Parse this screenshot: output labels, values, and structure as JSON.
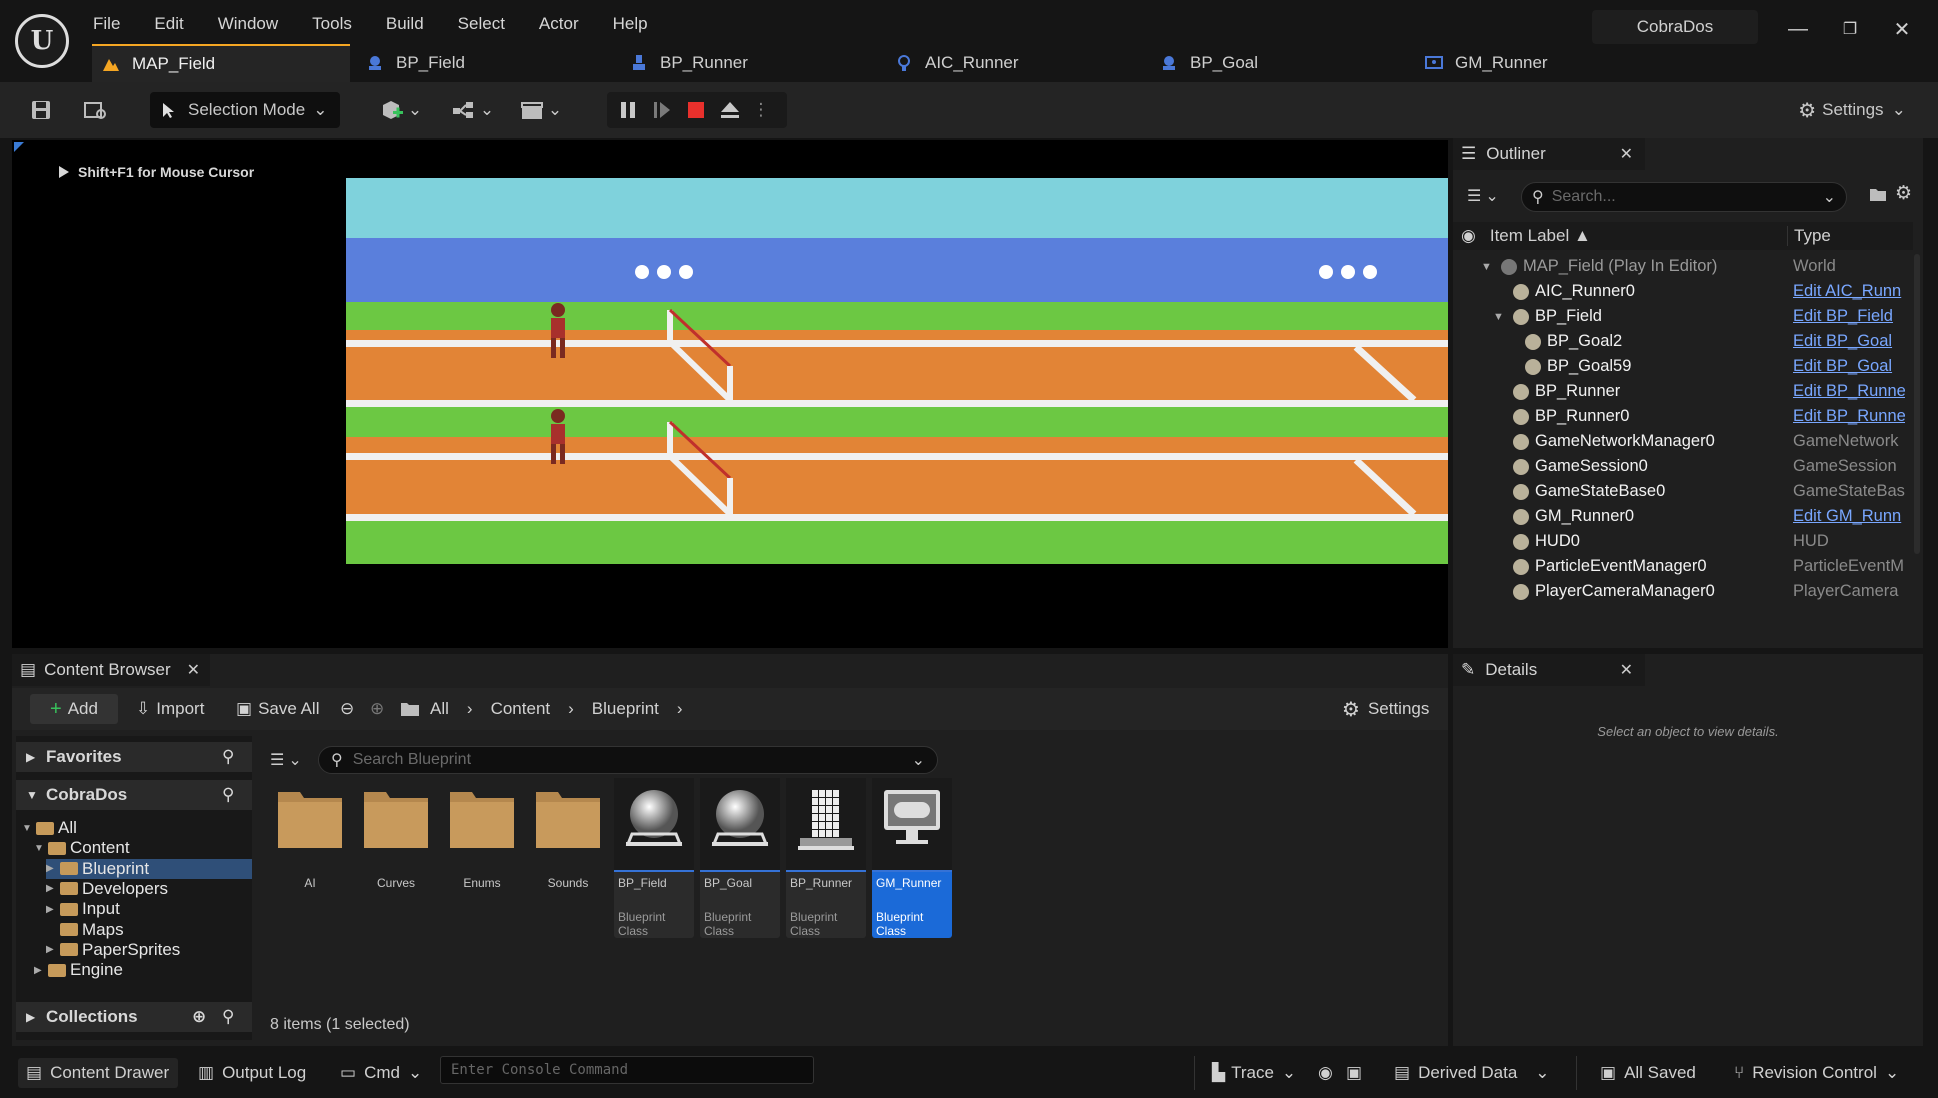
{
  "app": {
    "project_name": "CobraDos",
    "menu": [
      "File",
      "Edit",
      "Window",
      "Tools",
      "Build",
      "Select",
      "Actor",
      "Help"
    ],
    "window_controls": {
      "minimize": "—",
      "restore": "❐",
      "close": "✕"
    }
  },
  "tabs": [
    {
      "label": "MAP_Field",
      "icon": "level-icon",
      "active": true
    },
    {
      "label": "BP_Field",
      "icon": "blueprint-icon",
      "active": false
    },
    {
      "label": "BP_Runner",
      "icon": "blueprint-icon",
      "active": false
    },
    {
      "label": "AIC_Runner",
      "icon": "ai-controller-icon",
      "active": false
    },
    {
      "label": "BP_Goal",
      "icon": "blueprint-icon",
      "active": false
    },
    {
      "label": "GM_Runner",
      "icon": "game-mode-icon",
      "active": false
    }
  ],
  "toolbar": {
    "selection_mode": "Selection Mode",
    "settings": "Settings"
  },
  "viewport": {
    "hint": "Shift+F1 for Mouse Cursor"
  },
  "outliner": {
    "title": "Outliner",
    "search_placeholder": "Search...",
    "col_label": "Item Label ▲",
    "col_type": "Type",
    "rows": [
      {
        "label": "MAP_Field (Play In Editor)",
        "type": "World",
        "link": false,
        "indent": 0,
        "dim": true,
        "expander": "▼"
      },
      {
        "label": "AIC_Runner0",
        "type": "Edit AIC_Runn",
        "link": true,
        "indent": 1
      },
      {
        "label": "BP_Field",
        "type": "Edit BP_Field",
        "link": true,
        "indent": 1,
        "expander": "▼"
      },
      {
        "label": "BP_Goal2",
        "type": "Edit BP_Goal",
        "link": true,
        "indent": 2
      },
      {
        "label": "BP_Goal59",
        "type": "Edit BP_Goal",
        "link": true,
        "indent": 2
      },
      {
        "label": "BP_Runner",
        "type": "Edit BP_Runne",
        "link": true,
        "indent": 1
      },
      {
        "label": "BP_Runner0",
        "type": "Edit BP_Runne",
        "link": true,
        "indent": 1
      },
      {
        "label": "GameNetworkManager0",
        "type": "GameNetwork",
        "link": false,
        "indent": 1
      },
      {
        "label": "GameSession0",
        "type": "GameSession",
        "link": false,
        "indent": 1
      },
      {
        "label": "GameStateBase0",
        "type": "GameStateBas",
        "link": false,
        "indent": 1
      },
      {
        "label": "GM_Runner0",
        "type": "Edit GM_Runn",
        "link": true,
        "indent": 1
      },
      {
        "label": "HUD0",
        "type": "HUD",
        "link": false,
        "indent": 1
      },
      {
        "label": "ParticleEventManager0",
        "type": "ParticleEventM",
        "link": false,
        "indent": 1
      },
      {
        "label": "PlayerCameraManager0",
        "type": "PlayerCamera",
        "link": false,
        "indent": 1
      }
    ]
  },
  "details": {
    "title": "Details",
    "empty_text": "Select an object to view details."
  },
  "content_browser": {
    "title": "Content Browser",
    "add": "Add",
    "import": "Import",
    "save_all": "Save All",
    "breadcrumb": [
      "All",
      "Content",
      "Blueprint"
    ],
    "settings": "Settings",
    "favorites": "Favorites",
    "project": "CobraDos",
    "collections": "Collections",
    "search_placeholder": "Search Blueprint",
    "tree": [
      {
        "label": "All",
        "level": 0,
        "expander": "▼"
      },
      {
        "label": "Content",
        "level": 1,
        "expander": "▼"
      },
      {
        "label": "Blueprint",
        "level": 2,
        "expander": "▶",
        "selected": true
      },
      {
        "label": "Developers",
        "level": 2,
        "expander": "▶"
      },
      {
        "label": "Input",
        "level": 2,
        "expander": "▶"
      },
      {
        "label": "Maps",
        "level": 2,
        "expander": ""
      },
      {
        "label": "PaperSprites",
        "level": 2,
        "expander": "▶"
      },
      {
        "label": "Engine",
        "level": 1,
        "expander": "▶"
      }
    ],
    "assets": [
      {
        "name": "AI",
        "kind": "folder"
      },
      {
        "name": "Curves",
        "kind": "folder"
      },
      {
        "name": "Enums",
        "kind": "folder"
      },
      {
        "name": "Sounds",
        "kind": "folder"
      },
      {
        "name": "BP_Field",
        "kind": "blueprint",
        "class": "Blueprint Class",
        "thumb": "sphere"
      },
      {
        "name": "BP_Goal",
        "kind": "blueprint",
        "class": "Blueprint Class",
        "thumb": "sphere"
      },
      {
        "name": "BP_Runner",
        "kind": "blueprint",
        "class": "Blueprint Class",
        "thumb": "mannequin"
      },
      {
        "name": "GM_Runner",
        "kind": "blueprint",
        "class": "Blueprint Class",
        "thumb": "gamemode",
        "selected": true
      }
    ],
    "status": "8 items (1 selected)"
  },
  "statusbar": {
    "content_drawer": "Content Drawer",
    "output_log": "Output Log",
    "cmd": "Cmd",
    "console_placeholder": "Enter Console Command",
    "trace": "Trace",
    "derived_data": "Derived Data",
    "all_saved": "All Saved",
    "revision_control": "Revision Control"
  },
  "colors": {
    "accent": "#f5a623",
    "selection": "#1b6ad8",
    "link": "#79a7ff",
    "sky": "#7fd2dc",
    "stands": "#5a7fdc",
    "grass": "#6cc843",
    "track": "#e28436"
  }
}
